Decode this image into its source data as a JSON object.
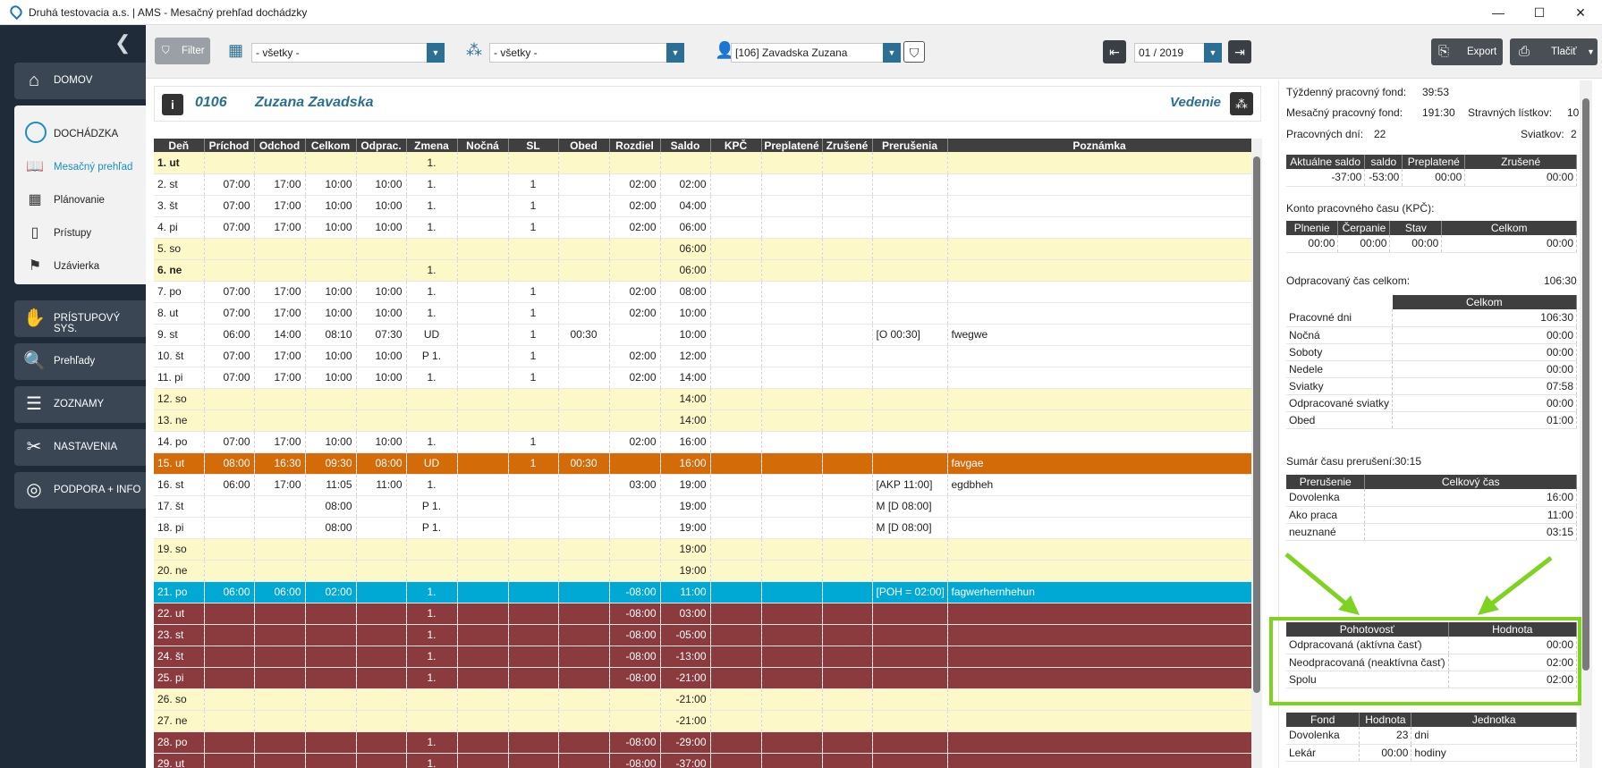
{
  "window": {
    "title": "Druhá testovacia a.s. | AMS - Mesačný prehľad dochádzky",
    "min": "—",
    "max": "☐",
    "close": "✕"
  },
  "sidebar": {
    "collapse": "❮",
    "nav": [
      {
        "label": "DOMOV",
        "icon": "home-icon",
        "glyph": "⌂"
      },
      {
        "label": "PRÍSTUPOVÝ SYS.",
        "icon": "handshake-icon",
        "glyph": "✋"
      },
      {
        "label": "Prehľady",
        "icon": "magnifier-icon",
        "glyph": "🔍"
      },
      {
        "label": "ZOZNAMY",
        "icon": "list-icon",
        "glyph": "☰"
      },
      {
        "label": "NASTAVENIA",
        "icon": "tools-icon",
        "glyph": "✂"
      },
      {
        "label": "PODPORA + INFO",
        "icon": "lifebuoy-icon",
        "glyph": "◎"
      }
    ],
    "section": {
      "label": "DOCHÁDZKA",
      "icon": "clock-icon"
    },
    "subitems": [
      {
        "label": "Mesačný prehľad",
        "icon": "book-icon",
        "glyph": "📖"
      },
      {
        "label": "Plánovanie",
        "icon": "calendar-icon",
        "glyph": "▦"
      },
      {
        "label": "Prístupy",
        "icon": "door-icon",
        "glyph": "▯"
      },
      {
        "label": "Uzávierka",
        "icon": "flag-icon",
        "glyph": "⚑"
      }
    ]
  },
  "toolbar": {
    "filter_label": "Filter",
    "filter_glyph": "⛉",
    "combo1": "- všetky -",
    "combo2": "- všetky -",
    "employee": "[106] Zavadska Zuzana",
    "period": "01 / 2019",
    "export_label": "Export",
    "print_label": "Tlačiť",
    "dropdown_glyph": "▼",
    "prev_glyph": "⇤",
    "next_glyph": "⇥"
  },
  "header": {
    "code": "0106",
    "name": "Zuzana Zavadska",
    "dept": "Vedenie"
  },
  "grid": {
    "columns": [
      "Deň",
      "Príchod",
      "Odchod",
      "Celkom",
      "Odprac.",
      "Zmena",
      "Nočná",
      "SL",
      "Obed",
      "Rozdiel",
      "Saldo",
      "KPČ",
      "Preplatené",
      "Zrušené",
      "Prerušenia",
      "Poznámka"
    ],
    "rows": [
      {
        "t": "we",
        "b": 1,
        "c": [
          "1. ut",
          "",
          "",
          "",
          "",
          "1.",
          "",
          "",
          "",
          "",
          "",
          "",
          "",
          "",
          "",
          ""
        ]
      },
      {
        "t": "wk",
        "b": 0,
        "c": [
          "2. st",
          "07:00",
          "17:00",
          "10:00",
          "10:00",
          "1.",
          "",
          "1",
          "",
          "02:00",
          "02:00",
          "",
          "",
          "",
          "",
          ""
        ]
      },
      {
        "t": "wk",
        "b": 0,
        "c": [
          "3. št",
          "07:00",
          "17:00",
          "10:00",
          "10:00",
          "1.",
          "",
          "1",
          "",
          "02:00",
          "04:00",
          "",
          "",
          "",
          "",
          ""
        ]
      },
      {
        "t": "wk",
        "b": 0,
        "c": [
          "4. pi",
          "07:00",
          "17:00",
          "10:00",
          "10:00",
          "1.",
          "",
          "1",
          "",
          "02:00",
          "06:00",
          "",
          "",
          "",
          "",
          ""
        ]
      },
      {
        "t": "we",
        "b": 0,
        "c": [
          "5. so",
          "",
          "",
          "",
          "",
          "",
          "",
          "",
          "",
          "",
          "06:00",
          "",
          "",
          "",
          "",
          ""
        ]
      },
      {
        "t": "we",
        "b": 1,
        "c": [
          "6. ne",
          "",
          "",
          "",
          "",
          "1.",
          "",
          "",
          "",
          "",
          "06:00",
          "",
          "",
          "",
          "",
          ""
        ]
      },
      {
        "t": "wk",
        "b": 0,
        "c": [
          "7. po",
          "07:00",
          "17:00",
          "10:00",
          "10:00",
          "1.",
          "",
          "1",
          "",
          "02:00",
          "08:00",
          "",
          "",
          "",
          "",
          ""
        ]
      },
      {
        "t": "wk",
        "b": 0,
        "c": [
          "8. ut",
          "07:00",
          "17:00",
          "10:00",
          "10:00",
          "1.",
          "",
          "1",
          "",
          "02:00",
          "10:00",
          "",
          "",
          "",
          "",
          ""
        ]
      },
      {
        "t": "wk",
        "b": 0,
        "c": [
          "9. st",
          "06:00",
          "14:00",
          "08:10",
          "07:30",
          "UD",
          "",
          "1",
          "00:30",
          "",
          "10:00",
          "",
          "",
          "",
          "[O 00:30]",
          "fwegwe"
        ]
      },
      {
        "t": "wk",
        "b": 0,
        "c": [
          "10. št",
          "07:00",
          "17:00",
          "10:00",
          "10:00",
          "P 1.",
          "",
          "1",
          "",
          "02:00",
          "12:00",
          "",
          "",
          "",
          "",
          ""
        ]
      },
      {
        "t": "wk",
        "b": 0,
        "c": [
          "11. pi",
          "07:00",
          "17:00",
          "10:00",
          "10:00",
          "1.",
          "",
          "1",
          "",
          "02:00",
          "14:00",
          "",
          "",
          "",
          "",
          ""
        ]
      },
      {
        "t": "we",
        "b": 0,
        "c": [
          "12. so",
          "",
          "",
          "",
          "",
          "",
          "",
          "",
          "",
          "",
          "14:00",
          "",
          "",
          "",
          "",
          ""
        ]
      },
      {
        "t": "we",
        "b": 0,
        "c": [
          "13. ne",
          "",
          "",
          "",
          "",
          "",
          "",
          "",
          "",
          "",
          "14:00",
          "",
          "",
          "",
          "",
          ""
        ]
      },
      {
        "t": "wk",
        "b": 0,
        "c": [
          "14. po",
          "07:00",
          "17:00",
          "10:00",
          "10:00",
          "1.",
          "",
          "1",
          "",
          "02:00",
          "16:00",
          "",
          "",
          "",
          "",
          ""
        ]
      },
      {
        "t": "or",
        "b": 0,
        "c": [
          "15. ut",
          "08:00",
          "16:30",
          "09:30",
          "08:00",
          "UD",
          "",
          "1",
          "00:30",
          "",
          "16:00",
          "",
          "",
          "",
          "",
          "favgae"
        ]
      },
      {
        "t": "wk",
        "b": 0,
        "c": [
          "16. st",
          "06:00",
          "17:00",
          "11:05",
          "11:00",
          "1.",
          "",
          "",
          "",
          "03:00",
          "19:00",
          "",
          "",
          "",
          "[AKP 11:00]",
          "egdbheh"
        ]
      },
      {
        "t": "wk",
        "b": 0,
        "c": [
          "17. št",
          "",
          "",
          "08:00",
          "",
          "P 1.",
          "",
          "",
          "",
          "",
          "19:00",
          "",
          "",
          "",
          "M [D 08:00]",
          ""
        ]
      },
      {
        "t": "wk",
        "b": 0,
        "c": [
          "18. pi",
          "",
          "",
          "08:00",
          "",
          "P 1.",
          "",
          "",
          "",
          "",
          "19:00",
          "",
          "",
          "",
          "M [D 08:00]",
          ""
        ]
      },
      {
        "t": "we",
        "b": 0,
        "c": [
          "19. so",
          "",
          "",
          "",
          "",
          "",
          "",
          "",
          "",
          "",
          "19:00",
          "",
          "",
          "",
          "",
          ""
        ]
      },
      {
        "t": "we",
        "b": 0,
        "c": [
          "20. ne",
          "",
          "",
          "",
          "",
          "",
          "",
          "",
          "",
          "",
          "19:00",
          "",
          "",
          "",
          "",
          ""
        ]
      },
      {
        "t": "bl",
        "b": 0,
        "c": [
          "21. po",
          "06:00",
          "06:00",
          "02:00",
          "",
          "1.",
          "",
          "",
          "",
          "-08:00",
          "11:00",
          "",
          "",
          "",
          "[POH = 02:00]",
          "fagwerhernhehun"
        ]
      },
      {
        "t": "dr",
        "b": 0,
        "c": [
          "22. ut",
          "",
          "",
          "",
          "",
          "1.",
          "",
          "",
          "",
          "-08:00",
          "03:00",
          "",
          "",
          "",
          "",
          ""
        ]
      },
      {
        "t": "dr",
        "b": 0,
        "c": [
          "23. st",
          "",
          "",
          "",
          "",
          "1.",
          "",
          "",
          "",
          "-08:00",
          "-05:00",
          "",
          "",
          "",
          "",
          ""
        ]
      },
      {
        "t": "dr",
        "b": 0,
        "c": [
          "24. št",
          "",
          "",
          "",
          "",
          "1.",
          "",
          "",
          "",
          "-08:00",
          "-13:00",
          "",
          "",
          "",
          "",
          ""
        ]
      },
      {
        "t": "dr",
        "b": 0,
        "c": [
          "25. pi",
          "",
          "",
          "",
          "",
          "1.",
          "",
          "",
          "",
          "-08:00",
          "-21:00",
          "",
          "",
          "",
          "",
          ""
        ]
      },
      {
        "t": "we",
        "b": 0,
        "c": [
          "26. so",
          "",
          "",
          "",
          "",
          "",
          "",
          "",
          "",
          "",
          "-21:00",
          "",
          "",
          "",
          "",
          ""
        ]
      },
      {
        "t": "we",
        "b": 0,
        "c": [
          "27. ne",
          "",
          "",
          "",
          "",
          "",
          "",
          "",
          "",
          "",
          "-21:00",
          "",
          "",
          "",
          "",
          ""
        ]
      },
      {
        "t": "dr",
        "b": 0,
        "c": [
          "28. po",
          "",
          "",
          "",
          "",
          "1.",
          "",
          "",
          "",
          "-08:00",
          "-29:00",
          "",
          "",
          "",
          "",
          ""
        ]
      },
      {
        "t": "dr",
        "b": 0,
        "c": [
          "29. ut",
          "",
          "",
          "",
          "",
          "1.",
          "",
          "",
          "",
          "-08:00",
          "-37:00",
          "",
          "",
          "",
          "",
          ""
        ]
      }
    ]
  },
  "summary": {
    "tyzdenny_label": "Týždenný pracovný fond:",
    "tyzdenny_value": "39:53",
    "mesacny_label": "Mesačný pracovný fond:",
    "mesacny_value": "191:30",
    "stravne_label": "Stravných lístkov:",
    "stravne_value": "10",
    "dni_label": "Pracovných dní:",
    "dni_value": "22",
    "sviatky_label": "Sviatkov:",
    "sviatky_value": "2",
    "saldo_table": {
      "headers": [
        "Aktuálne saldo",
        "saldo",
        "Preplatené",
        "Zrušené"
      ],
      "row": [
        "-37:00",
        "-53:00",
        "00:00",
        "00:00"
      ]
    },
    "kpc_title": "Konto pracovného času (KPČ):",
    "kpc_table": {
      "headers": [
        "Plnenie",
        "Čerpanie",
        "Stav",
        "Celkom"
      ],
      "row": [
        "00:00",
        "00:00",
        "00:00",
        "00:00"
      ]
    },
    "odprac_label": "Odpracovaný čas celkom:",
    "odprac_value": "106:30",
    "celkom_table": {
      "header": "Celkom",
      "rows": [
        [
          "Pracovné dni",
          "106:30"
        ],
        [
          "Nočná",
          "00:00"
        ],
        [
          "Soboty",
          "00:00"
        ],
        [
          "Nedele",
          "00:00"
        ],
        [
          "Sviatky",
          "07:58"
        ],
        [
          "Odpracované sviatky",
          "00:00"
        ],
        [
          "Obed",
          "01:00"
        ]
      ]
    },
    "prerus_label": "Sumár času prerušení:",
    "prerus_value": "30:15",
    "prerus_table": {
      "headers": [
        "Prerušenie",
        "Celkový čas"
      ],
      "rows": [
        [
          "Dovolenka",
          "16:00"
        ],
        [
          "Ako praca",
          "11:00"
        ],
        [
          "neuznané",
          "03:15"
        ]
      ]
    },
    "poh_table": {
      "headers": [
        "Pohotovosť",
        "Hodnota"
      ],
      "rows": [
        [
          "Odpracovaná (aktívna časť)",
          "00:00"
        ],
        [
          "Neodpracovaná (neaktívna časť)",
          "02:00"
        ],
        [
          "Spolu",
          "02:00"
        ]
      ]
    },
    "fond_table": {
      "headers": [
        "Fond",
        "Hodnota",
        "Jednotka"
      ],
      "rows": [
        [
          "Dovolenka",
          "23",
          "dni"
        ],
        [
          "Lekár",
          "00:00",
          "hodiny"
        ]
      ]
    }
  },
  "colors": {
    "accent": "#2a6f92",
    "highlight": "#7ed321",
    "orange": "#d46b09",
    "blue": "#00a8d4",
    "darkred": "#8b3a3e"
  }
}
